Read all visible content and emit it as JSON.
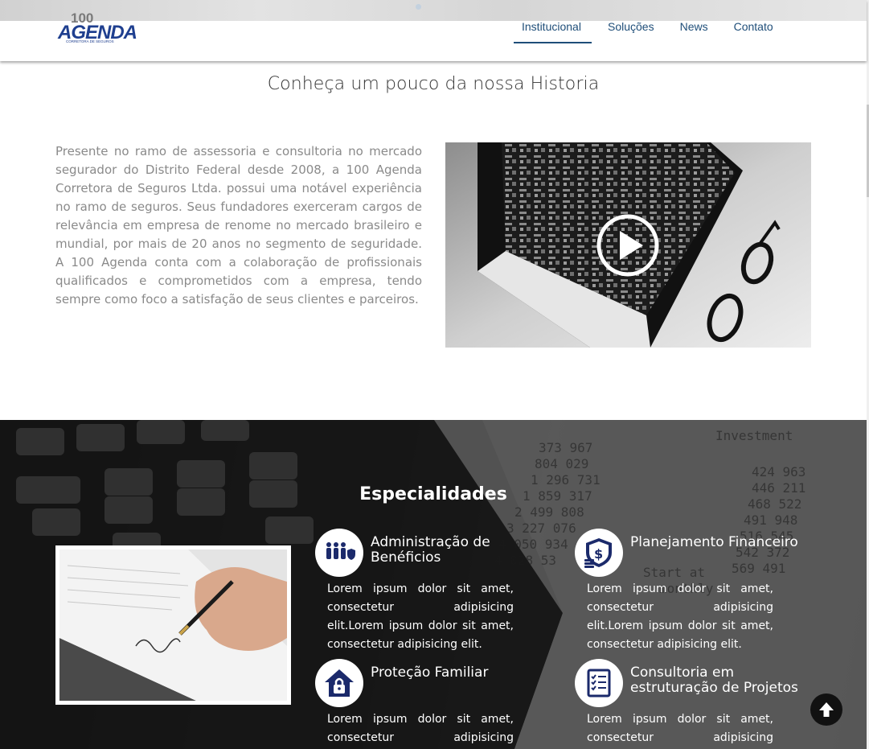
{
  "header": {
    "logo": {
      "number": "100",
      "name": "AGENDA",
      "tagline": "CORRETORA DE SEGUROS"
    },
    "nav": [
      {
        "label": "Institucional",
        "active": true
      },
      {
        "label": "Soluções",
        "active": false
      },
      {
        "label": "News",
        "active": false
      },
      {
        "label": "Contato",
        "active": false
      }
    ]
  },
  "history": {
    "title": "Conheça um pouco da nossa Historia",
    "text": "Presente no ramo de assessoria e consultoria no mercado segurador do Distrito Federal desde 2008, a 100 Agenda Corretora de Seguros Ltda. possui uma notável experiência no ramo de seguros. Seus fundadores exerceram cargos de relevância em empresa de renome no mercado brasileiro e mundial, por mais de 20 anos no segmento de seguridade. A 100 Agenda conta com a colaboração de profissionais qualificados e comprometidos com a empresa, tendo sempre como foco a satisfação de seus clientes e parceiros.",
    "video_icon": "play-icon"
  },
  "specialties": {
    "title": "Especialidades",
    "items": [
      {
        "icon": "benefits-icon",
        "title": "Administração de Benéficios",
        "text": "Lorem ipsum dolor sit amet, consectetur adipisicing elit.Lorem ipsum dolor sit amet, consectetur adipisicing elit."
      },
      {
        "icon": "financial-shield-icon",
        "title": "Planejamento Financeiro",
        "text": "Lorem ipsum dolor sit amet, consectetur adipisicing elit.Lorem ipsum dolor sit amet, consectetur adipisicing elit."
      },
      {
        "icon": "house-lock-icon",
        "title": "Proteção Familiar",
        "text": "Lorem ipsum dolor sit amet, consectetur adipisicing elit.Lorem"
      },
      {
        "icon": "checklist-icon",
        "title": "Consultoria em estruturação de Projetos",
        "text": "Lorem ipsum dolor sit amet, consectetur adipisicing elit.Lorem"
      }
    ]
  },
  "colors": {
    "brand": "#1f4e79",
    "nav_text": "#1f4e79",
    "body_text": "#8a8a8a",
    "icon_fg": "#1b2a6b"
  }
}
